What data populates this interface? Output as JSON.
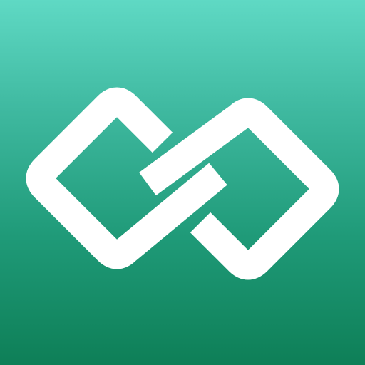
{
  "app_icon": {
    "icon_name": "chain-link-icon",
    "colors": {
      "background_top": "#5fd9c4",
      "background_bottom": "#0e7f57",
      "glyph": "#ffffff"
    }
  }
}
